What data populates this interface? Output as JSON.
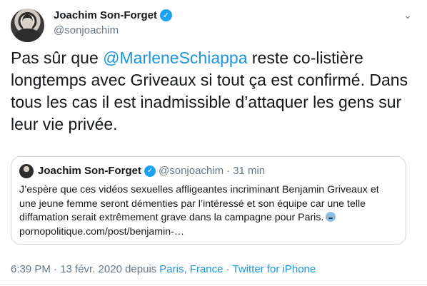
{
  "author": {
    "name": "Joachim Son-Forget",
    "handle": "@sonjoachim",
    "verified_icon": "verified-badge-icon"
  },
  "tweet": {
    "text_before": "Pas sûr que ",
    "mention": "@MarleneSchiappa",
    "text_after": " reste co-listière longtemps avec Griveaux si tout ça est confirmé. Dans tous les cas il est inadmissible d’attaquer les gens sur leur vie privée."
  },
  "quoted": {
    "name": "Joachim Son-Forget",
    "handle": "@sonjoachim",
    "separator": "·",
    "time": "31 min",
    "text": "J’espère que ces vidéos sexuelles affligeantes incriminant Benjamin Griveaux et une jeune femme seront démenties par l’intéressé et son équipe car une telle diffamation serait extrêmement grave dans la campagne pour Paris.",
    "link": "pornopolitique.com/post/benjamin-…",
    "emoji_icon": "face-emoji-icon"
  },
  "meta": {
    "time_date": "6:39 PM · 13 févr. 2020 depuis",
    "location": "Paris, France",
    "separator": "·",
    "source": "Twitter for iPhone"
  },
  "colors": {
    "link": "#1b95e0",
    "verified": "#1da1f2",
    "secondary_text": "#657786",
    "border": "#ccd6dd"
  }
}
